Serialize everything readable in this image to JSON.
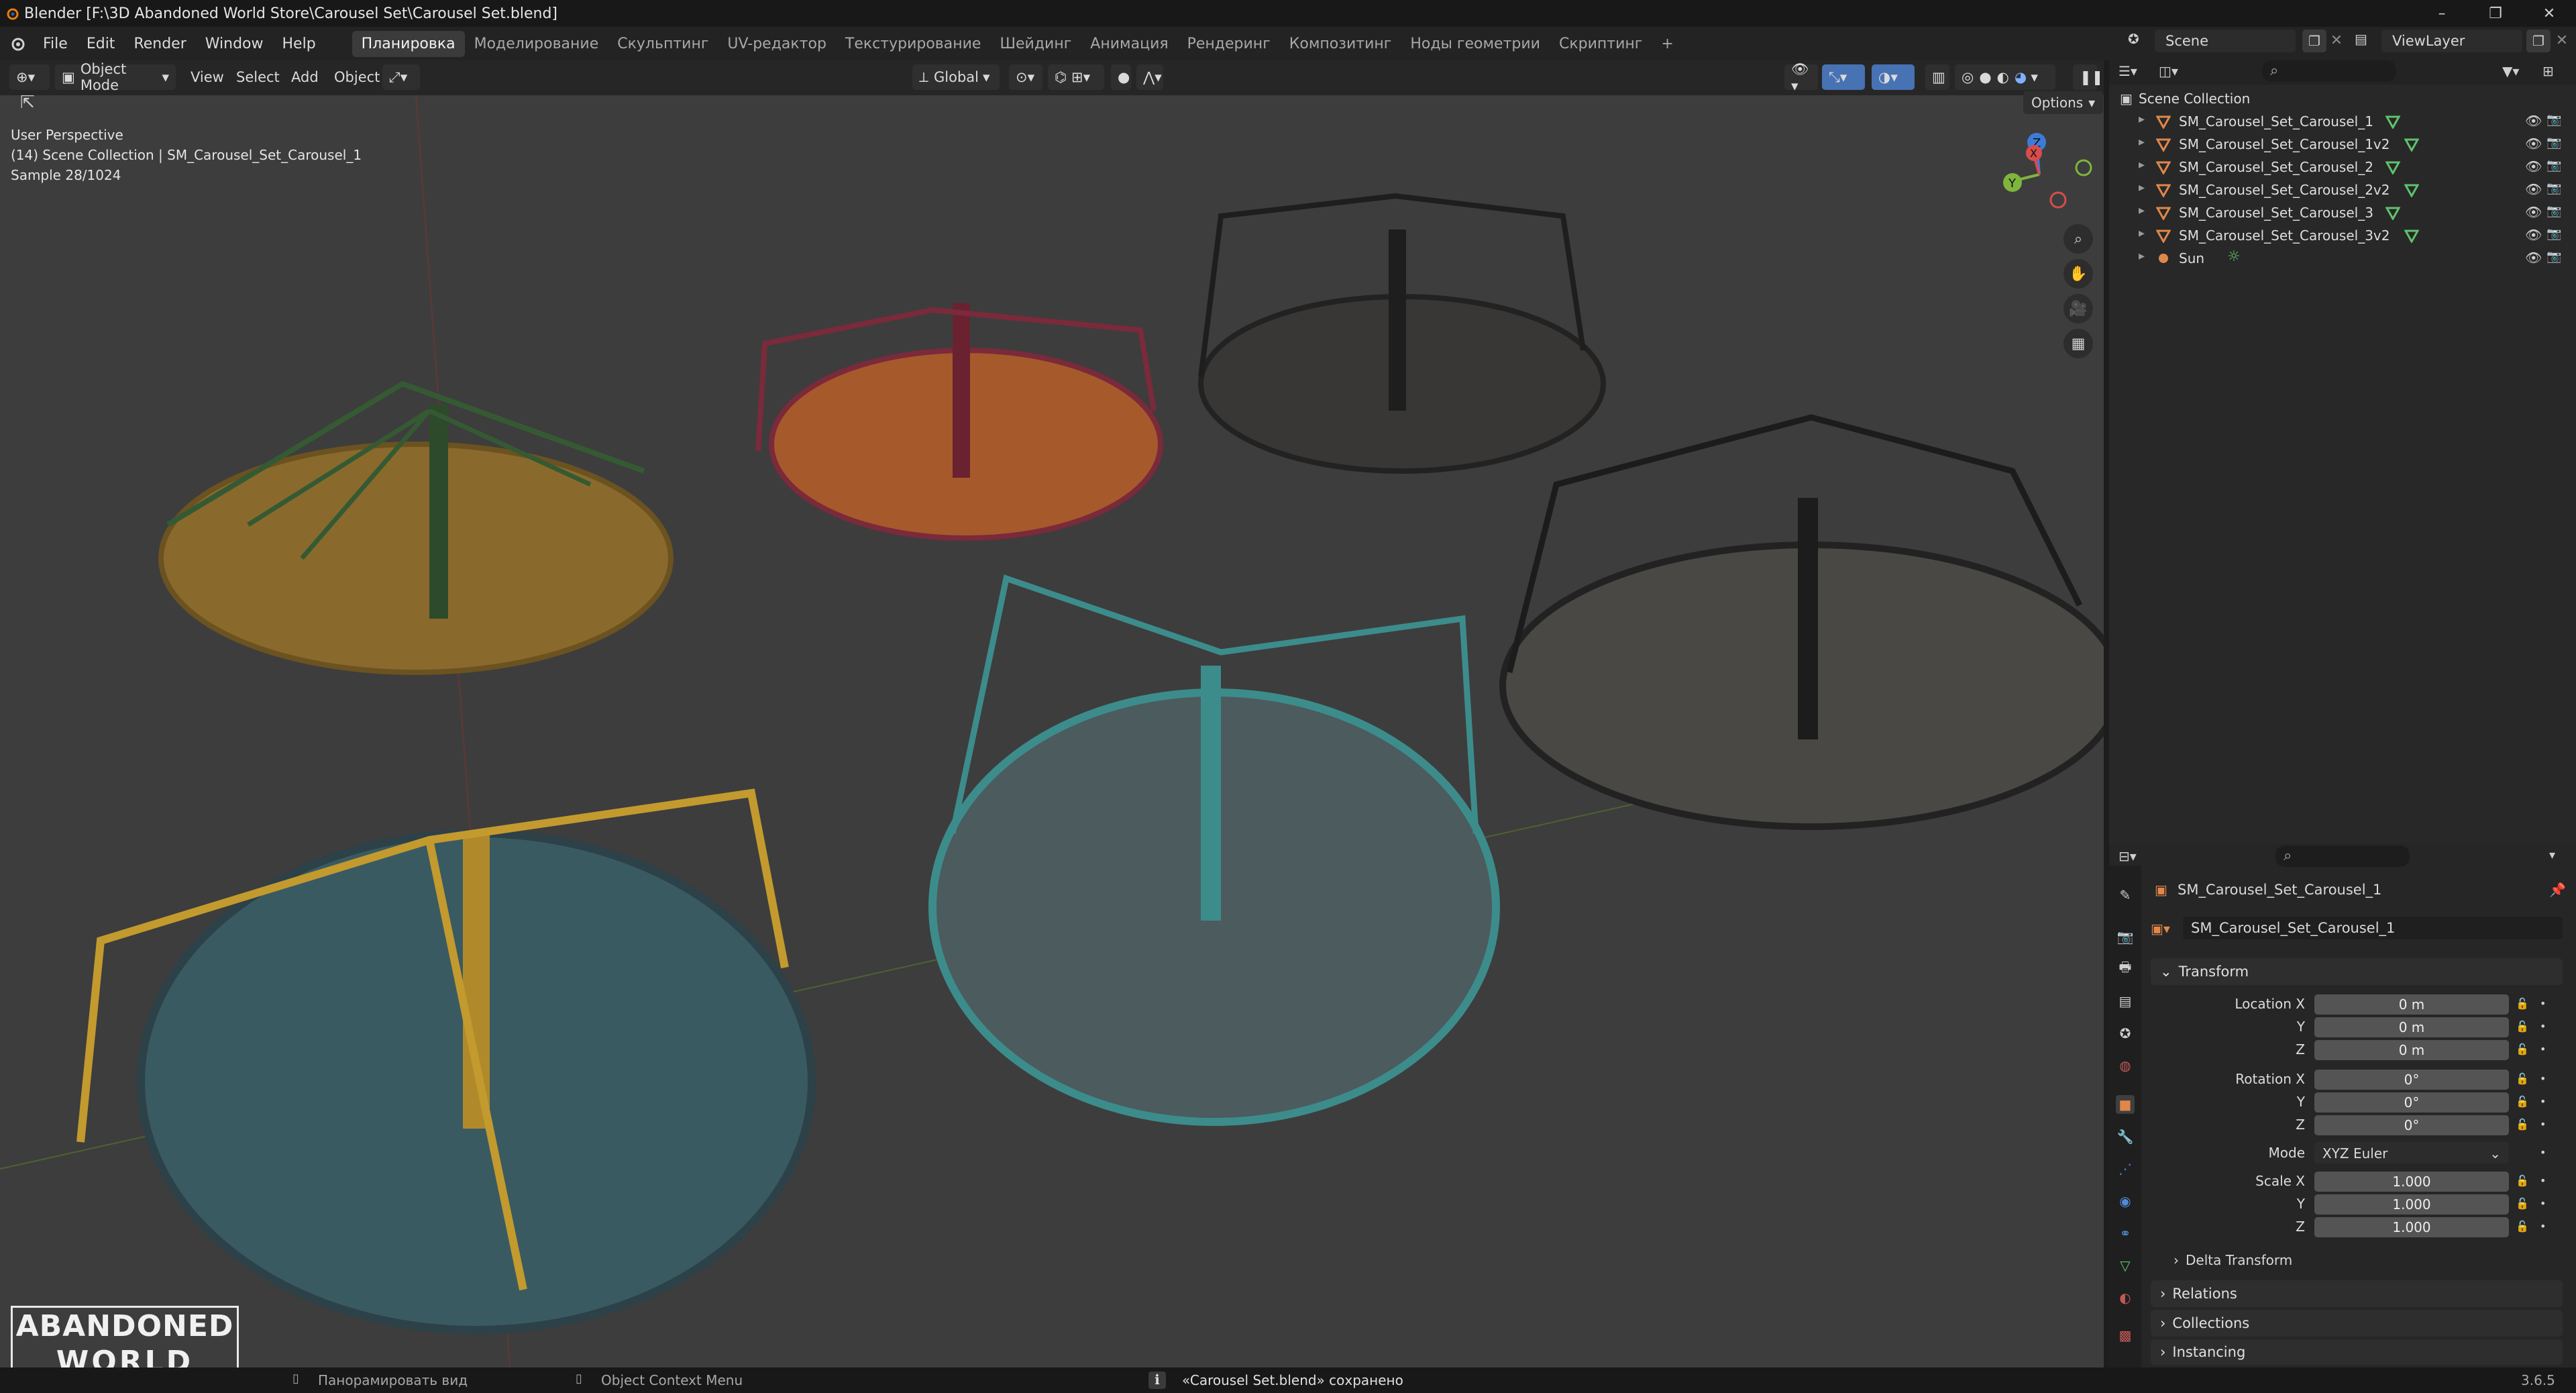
{
  "titlebar": {
    "title": "Blender [F:\\3D Abandoned World Store\\Carousel Set\\Carousel Set.blend]",
    "minimize": "–",
    "maximize": "❐",
    "close": "✕"
  },
  "menu": [
    "File",
    "Edit",
    "Render",
    "Window",
    "Help"
  ],
  "workspaces": [
    "Планировка",
    "Моделирование",
    "Скульптинг",
    "UV-редактор",
    "Текстурирование",
    "Шейдинг",
    "Анимация",
    "Рендеринг",
    "Композитинг",
    "Ноды геометрии",
    "Скриптинг"
  ],
  "workspace_add": "+",
  "scene": {
    "label": "Scene"
  },
  "view_layer": {
    "label": "ViewLayer"
  },
  "viewport_header": {
    "mode": "Object Mode",
    "view": "View",
    "select": "Select",
    "add": "Add",
    "object": "Object",
    "orientation": "Global",
    "options": "Options"
  },
  "viewport_info": {
    "perspective": "User Perspective",
    "collection": "(14) Scene Collection | SM_Carousel_Set_Carousel_1",
    "sample": "Sample 28/1024"
  },
  "gizmo": {
    "x": "X",
    "y": "Y",
    "z": "Z"
  },
  "outliner": {
    "root": "Scene Collection",
    "items": [
      {
        "label": "SM_Carousel_Set_Carousel_1",
        "type": "mesh"
      },
      {
        "label": "SM_Carousel_Set_Carousel_1v2",
        "type": "mesh"
      },
      {
        "label": "SM_Carousel_Set_Carousel_2",
        "type": "mesh"
      },
      {
        "label": "SM_Carousel_Set_Carousel_2v2",
        "type": "mesh"
      },
      {
        "label": "SM_Carousel_Set_Carousel_3",
        "type": "mesh"
      },
      {
        "label": "SM_Carousel_Set_Carousel_3v2",
        "type": "mesh"
      },
      {
        "label": "Sun",
        "type": "light"
      }
    ]
  },
  "properties": {
    "object_name": "SM_Carousel_Set_Carousel_1",
    "object_name_field": "SM_Carousel_Set_Carousel_1",
    "transform_title": "Transform",
    "location": {
      "label_x": "Location X",
      "label_y": "Y",
      "label_z": "Z",
      "x": "0 m",
      "y": "0 m",
      "z": "0 m"
    },
    "rotation": {
      "label_x": "Rotation X",
      "label_y": "Y",
      "label_z": "Z",
      "x": "0°",
      "y": "0°",
      "z": "0°"
    },
    "mode": {
      "label": "Mode",
      "value": "XYZ Euler"
    },
    "scale": {
      "label_x": "Scale X",
      "label_y": "Y",
      "label_z": "Z",
      "x": "1.000",
      "y": "1.000",
      "z": "1.000"
    },
    "delta_transform": "Delta Transform",
    "relations": "Relations",
    "collections": "Collections",
    "instancing": "Instancing"
  },
  "statusbar": {
    "pan_view": "Панорамировать вид",
    "context_menu": "Object Context Menu",
    "saved": "«Carousel Set.blend» сохранено",
    "version": "3.6.5"
  },
  "logo": {
    "line1": "ABANDONED",
    "line2": "WORLD"
  },
  "colors": {
    "accent": "#4772b3",
    "mesh_icon": "#e0874a",
    "modifier_icon": "#5fc26b",
    "viewport_bg": "#3d3d3d"
  }
}
